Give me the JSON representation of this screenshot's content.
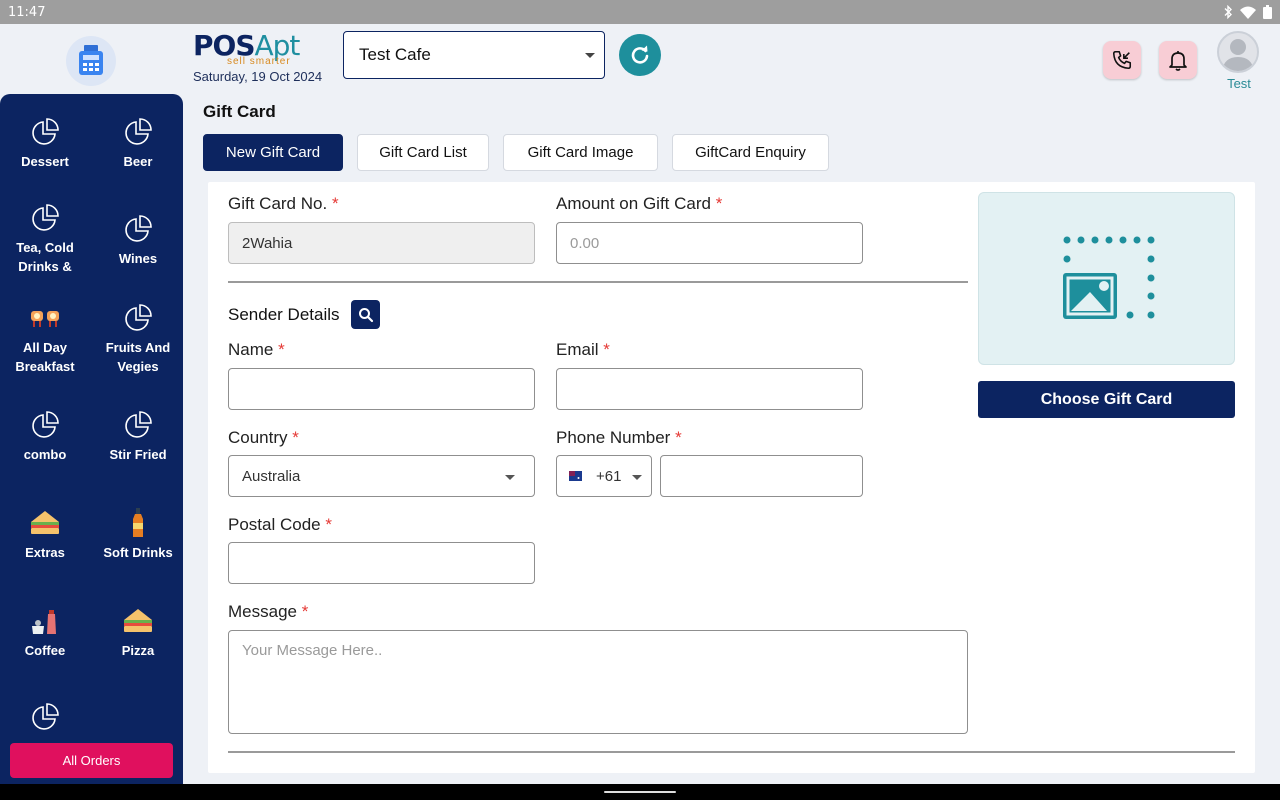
{
  "status_bar": {
    "time": "11:47"
  },
  "header": {
    "logo_main": "POS",
    "logo_accent": "Apt",
    "logo_tagline": "sell smarter",
    "date": "Saturday, 19 Oct 2024",
    "store_selected": "Test Cafe",
    "user_name": "Test"
  },
  "sidebar": {
    "categories": [
      {
        "label": "Dessert",
        "icon": "pie-chart-icon"
      },
      {
        "label": "Beer",
        "icon": "pie-chart-icon"
      },
      {
        "label": "Tea, Cold Drinks &",
        "icon": "pie-chart-icon"
      },
      {
        "label": "Wines",
        "icon": "pie-chart-icon"
      },
      {
        "label": "All Day Breakfast",
        "icon": "breakfast-icon"
      },
      {
        "label": "Fruits And Vegies",
        "icon": "pie-chart-icon"
      },
      {
        "label": "combo",
        "icon": "pie-chart-icon"
      },
      {
        "label": "Stir Fried",
        "icon": "pie-chart-icon"
      },
      {
        "label": "Extras",
        "icon": "sandwich-icon"
      },
      {
        "label": "Soft Drinks",
        "icon": "bottle-icon"
      },
      {
        "label": "Coffee",
        "icon": "coffee-icon"
      },
      {
        "label": "Pizza",
        "icon": "sandwich-icon"
      },
      {
        "label": "",
        "icon": "pie-chart-icon"
      }
    ],
    "all_orders_label": "All Orders"
  },
  "main": {
    "page_title": "Gift Card",
    "tabs": [
      {
        "label": "New Gift Card",
        "active": true
      },
      {
        "label": "Gift Card List",
        "active": false
      },
      {
        "label": "Gift Card Image",
        "active": false
      },
      {
        "label": "GiftCard Enquiry",
        "active": false
      }
    ],
    "form": {
      "gift_card_no_label": "Gift Card No.",
      "gift_card_no_value": "2Wahia",
      "amount_label": "Amount on Gift Card",
      "amount_placeholder": "0.00",
      "sender_details_title": "Sender Details",
      "name_label": "Name",
      "name_value": "",
      "email_label": "Email",
      "email_value": "",
      "country_label": "Country",
      "country_value": "Australia",
      "phone_label": "Phone Number",
      "phone_code": "+61",
      "phone_value": "",
      "postal_code_label": "Postal Code",
      "postal_code_value": "",
      "message_label": "Message",
      "message_placeholder": "Your Message Here..",
      "required_mark": "*"
    },
    "choose_gift_card_label": "Choose Gift Card"
  },
  "colors": {
    "primary": "#0c2461",
    "accent_teal": "#1e8f9c",
    "all_orders": "#e0105e",
    "required": "#e53935"
  }
}
